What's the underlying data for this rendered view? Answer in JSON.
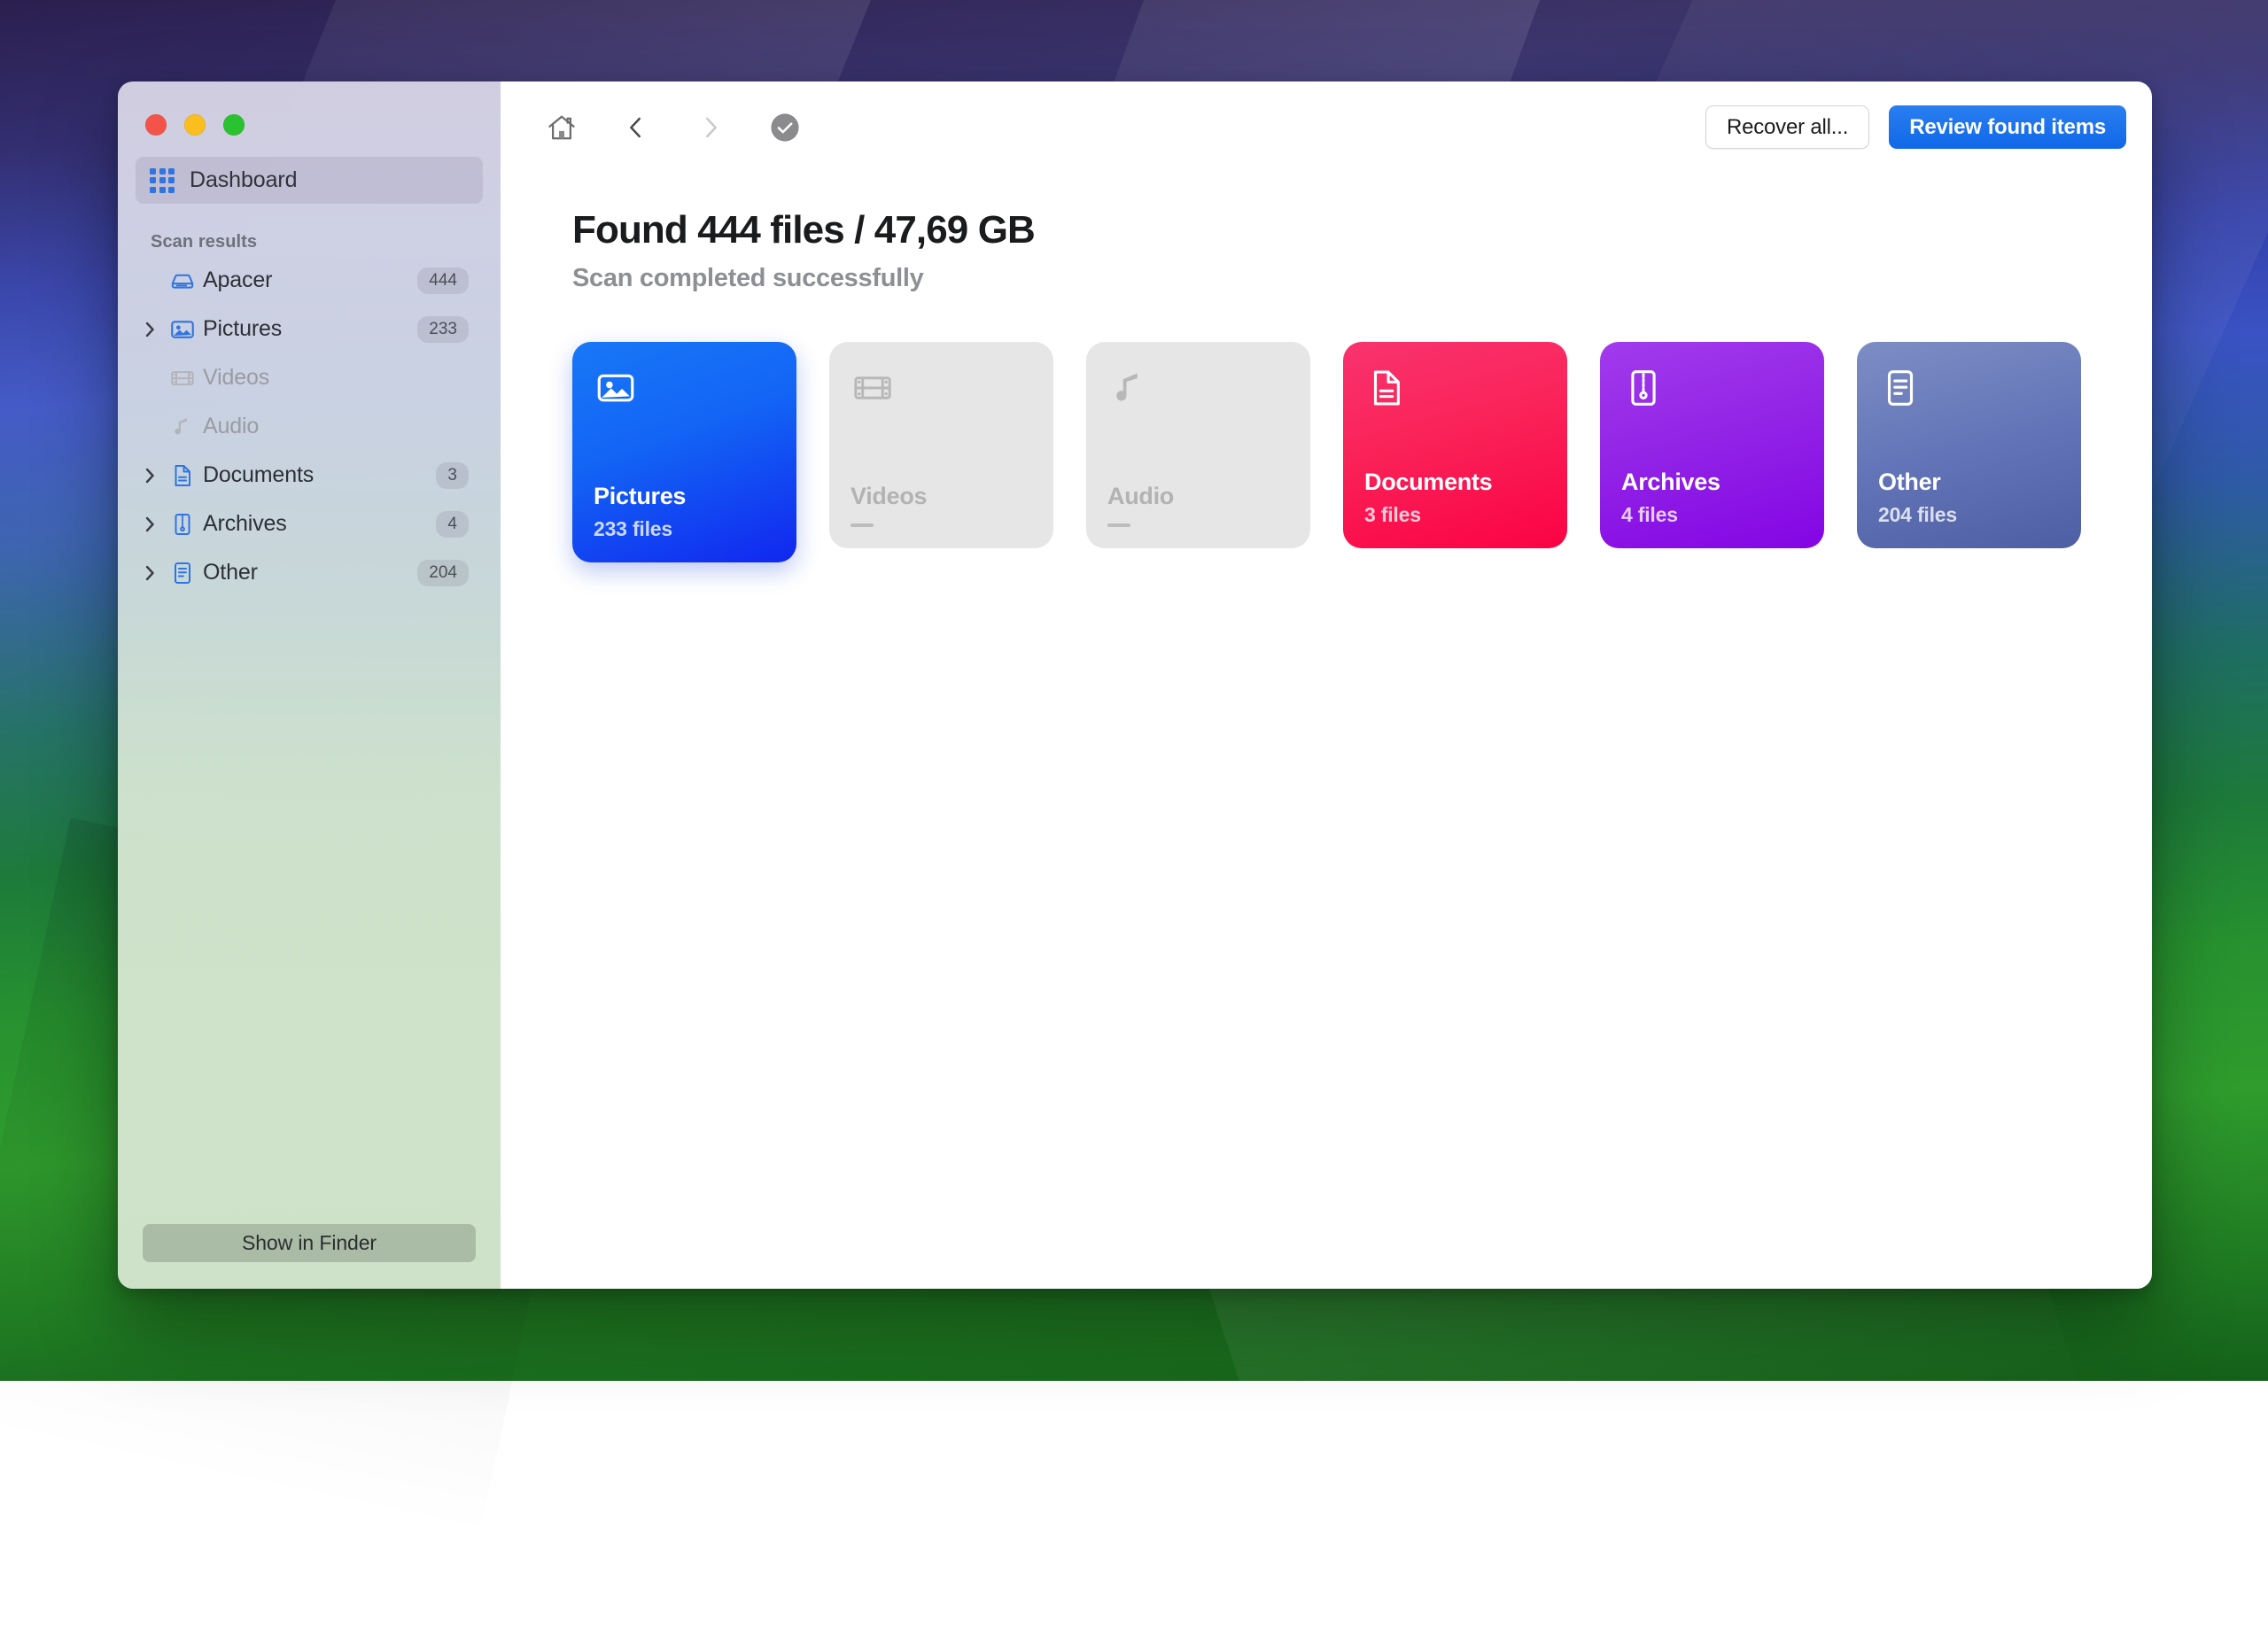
{
  "window": {
    "traffic_lights": [
      {
        "name": "close",
        "color": "#f3544a"
      },
      {
        "name": "minimize",
        "color": "#fbbe20"
      },
      {
        "name": "maximize",
        "color": "#2ac231"
      }
    ]
  },
  "sidebar": {
    "dashboard": {
      "label": "Dashboard",
      "icon": "grid-icon"
    },
    "section_title": "Scan results",
    "items": [
      {
        "label": "Apacer",
        "badge": "444",
        "icon": "drive-icon",
        "expandable": false,
        "dimmed": false
      },
      {
        "label": "Pictures",
        "badge": "233",
        "icon": "picture-icon",
        "expandable": true,
        "dimmed": false
      },
      {
        "label": "Videos",
        "badge": "",
        "icon": "film-icon",
        "expandable": false,
        "dimmed": true
      },
      {
        "label": "Audio",
        "badge": "",
        "icon": "music-icon",
        "expandable": false,
        "dimmed": true
      },
      {
        "label": "Documents",
        "badge": "3",
        "icon": "document-icon",
        "expandable": true,
        "dimmed": false
      },
      {
        "label": "Archives",
        "badge": "4",
        "icon": "archive-icon",
        "expandable": true,
        "dimmed": false
      },
      {
        "label": "Other",
        "badge": "204",
        "icon": "list-doc-icon",
        "expandable": true,
        "dimmed": false
      }
    ],
    "show_in_finder": "Show in Finder"
  },
  "toolbar": {
    "home_icon": "home-icon",
    "back_icon": "chevron-left-icon",
    "forward_icon": "chevron-right-icon",
    "status_icon": "check-circle-icon",
    "recover_all_label": "Recover all...",
    "review_label": "Review found items"
  },
  "main": {
    "title": "Found 444 files / 47,69 GB",
    "subtitle": "Scan completed successfully",
    "cards": [
      {
        "name": "Pictures",
        "count": "233 files",
        "icon": "picture-icon",
        "state": "active",
        "color": "#1365f5"
      },
      {
        "name": "Videos",
        "count": "—",
        "icon": "film-icon",
        "state": "disabled",
        "color": "#e6e6e6"
      },
      {
        "name": "Audio",
        "count": "—",
        "icon": "music-icon",
        "state": "disabled",
        "color": "#e6e6e6"
      },
      {
        "name": "Documents",
        "count": "3 files",
        "icon": "document-icon",
        "state": "normal",
        "color": "#fa2258"
      },
      {
        "name": "Archives",
        "count": "4 files",
        "icon": "archive-icon",
        "state": "normal",
        "color": "#9223e6"
      },
      {
        "name": "Other",
        "count": "204 files",
        "icon": "list-doc-icon",
        "state": "normal",
        "color": "#6375b8"
      }
    ]
  }
}
